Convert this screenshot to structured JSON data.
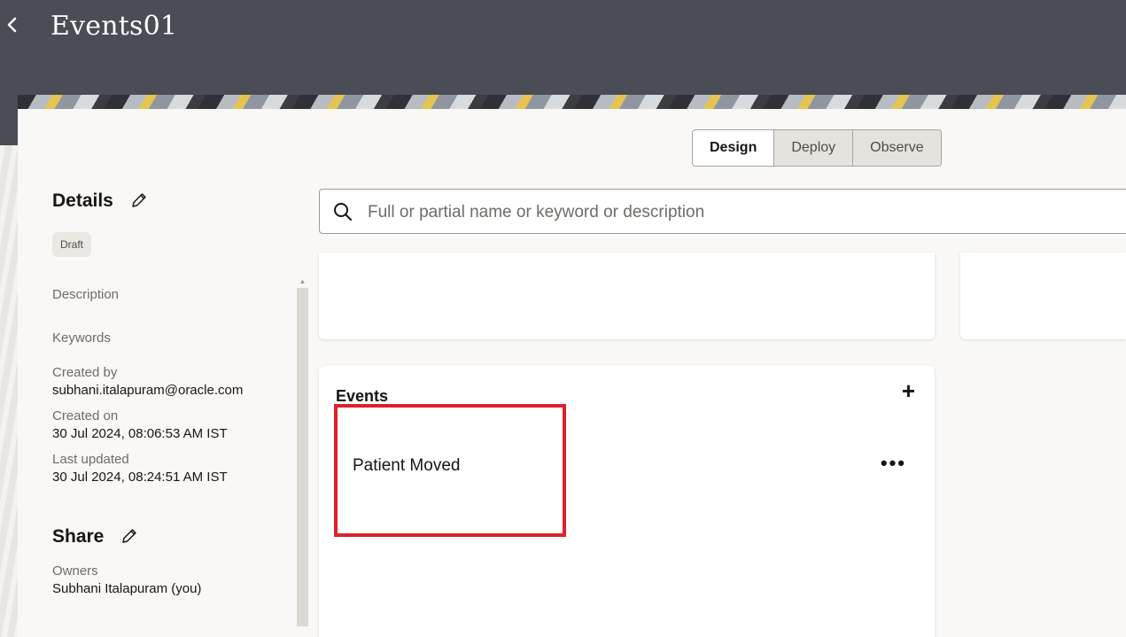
{
  "header": {
    "title": "Events01",
    "back_icon": "chevron-left-icon"
  },
  "tabs": [
    {
      "label": "Design",
      "active": true
    },
    {
      "label": "Deploy",
      "active": false
    },
    {
      "label": "Observe",
      "active": false
    }
  ],
  "details": {
    "heading": "Details",
    "status_badge": "Draft",
    "description_label": "Description",
    "keywords_label": "Keywords",
    "created_by_label": "Created by",
    "created_by_value": "subhani.italapuram@oracle.com",
    "created_on_label": "Created on",
    "created_on_value": "30 Jul 2024, 08:06:53 AM IST",
    "last_updated_label": "Last updated",
    "last_updated_value": "30 Jul 2024, 08:24:51 AM IST"
  },
  "share": {
    "heading": "Share",
    "owners_label": "Owners",
    "owners_value": "Subhani Italapuram (you)"
  },
  "search": {
    "placeholder": "Full or partial name or keyword or description",
    "value": ""
  },
  "events": {
    "heading": "Events",
    "add_label": "+",
    "items": [
      {
        "name": "Patient Moved",
        "more_label": "•••"
      }
    ]
  },
  "colors": {
    "header_bg": "#4a4d55",
    "highlight_border": "#e0202b",
    "card_bg": "#f9f8f6"
  }
}
